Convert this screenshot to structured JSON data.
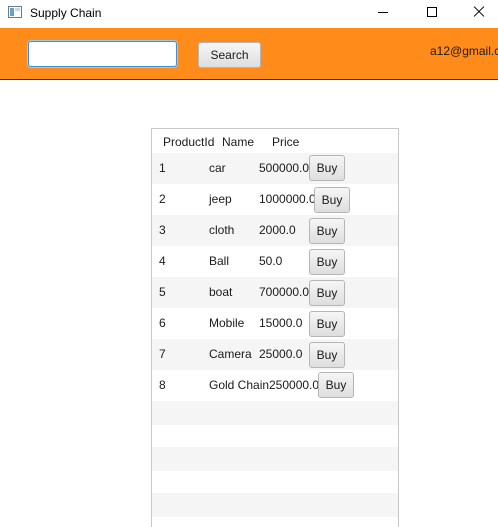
{
  "window": {
    "title": "Supply Chain",
    "icon": "app-window-icon",
    "controls": [
      "minimize-icon",
      "maximize-icon",
      "close-icon"
    ]
  },
  "toolbar": {
    "background_color": "#ff8c1a",
    "search_value": "",
    "search_label": "Search",
    "user_email": "a12@gmail.c"
  },
  "table": {
    "columns": [
      "ProductId",
      "Name",
      "Price"
    ],
    "buy_label": "Buy",
    "rows": [
      {
        "id": "1",
        "name": "car",
        "price": "500000.0"
      },
      {
        "id": "2",
        "name": "jeep",
        "price": "1000000.0"
      },
      {
        "id": "3",
        "name": "cloth",
        "price": "2000.0"
      },
      {
        "id": "4",
        "name": "Ball",
        "price": "50.0"
      },
      {
        "id": "5",
        "name": "boat",
        "price": "700000.0"
      },
      {
        "id": "6",
        "name": "Mobile",
        "price": "15000.0"
      },
      {
        "id": "7",
        "name": "Camera",
        "price": "25000.0"
      },
      {
        "id": "8",
        "name": "Gold Chain",
        "price": "250000.0"
      }
    ]
  }
}
